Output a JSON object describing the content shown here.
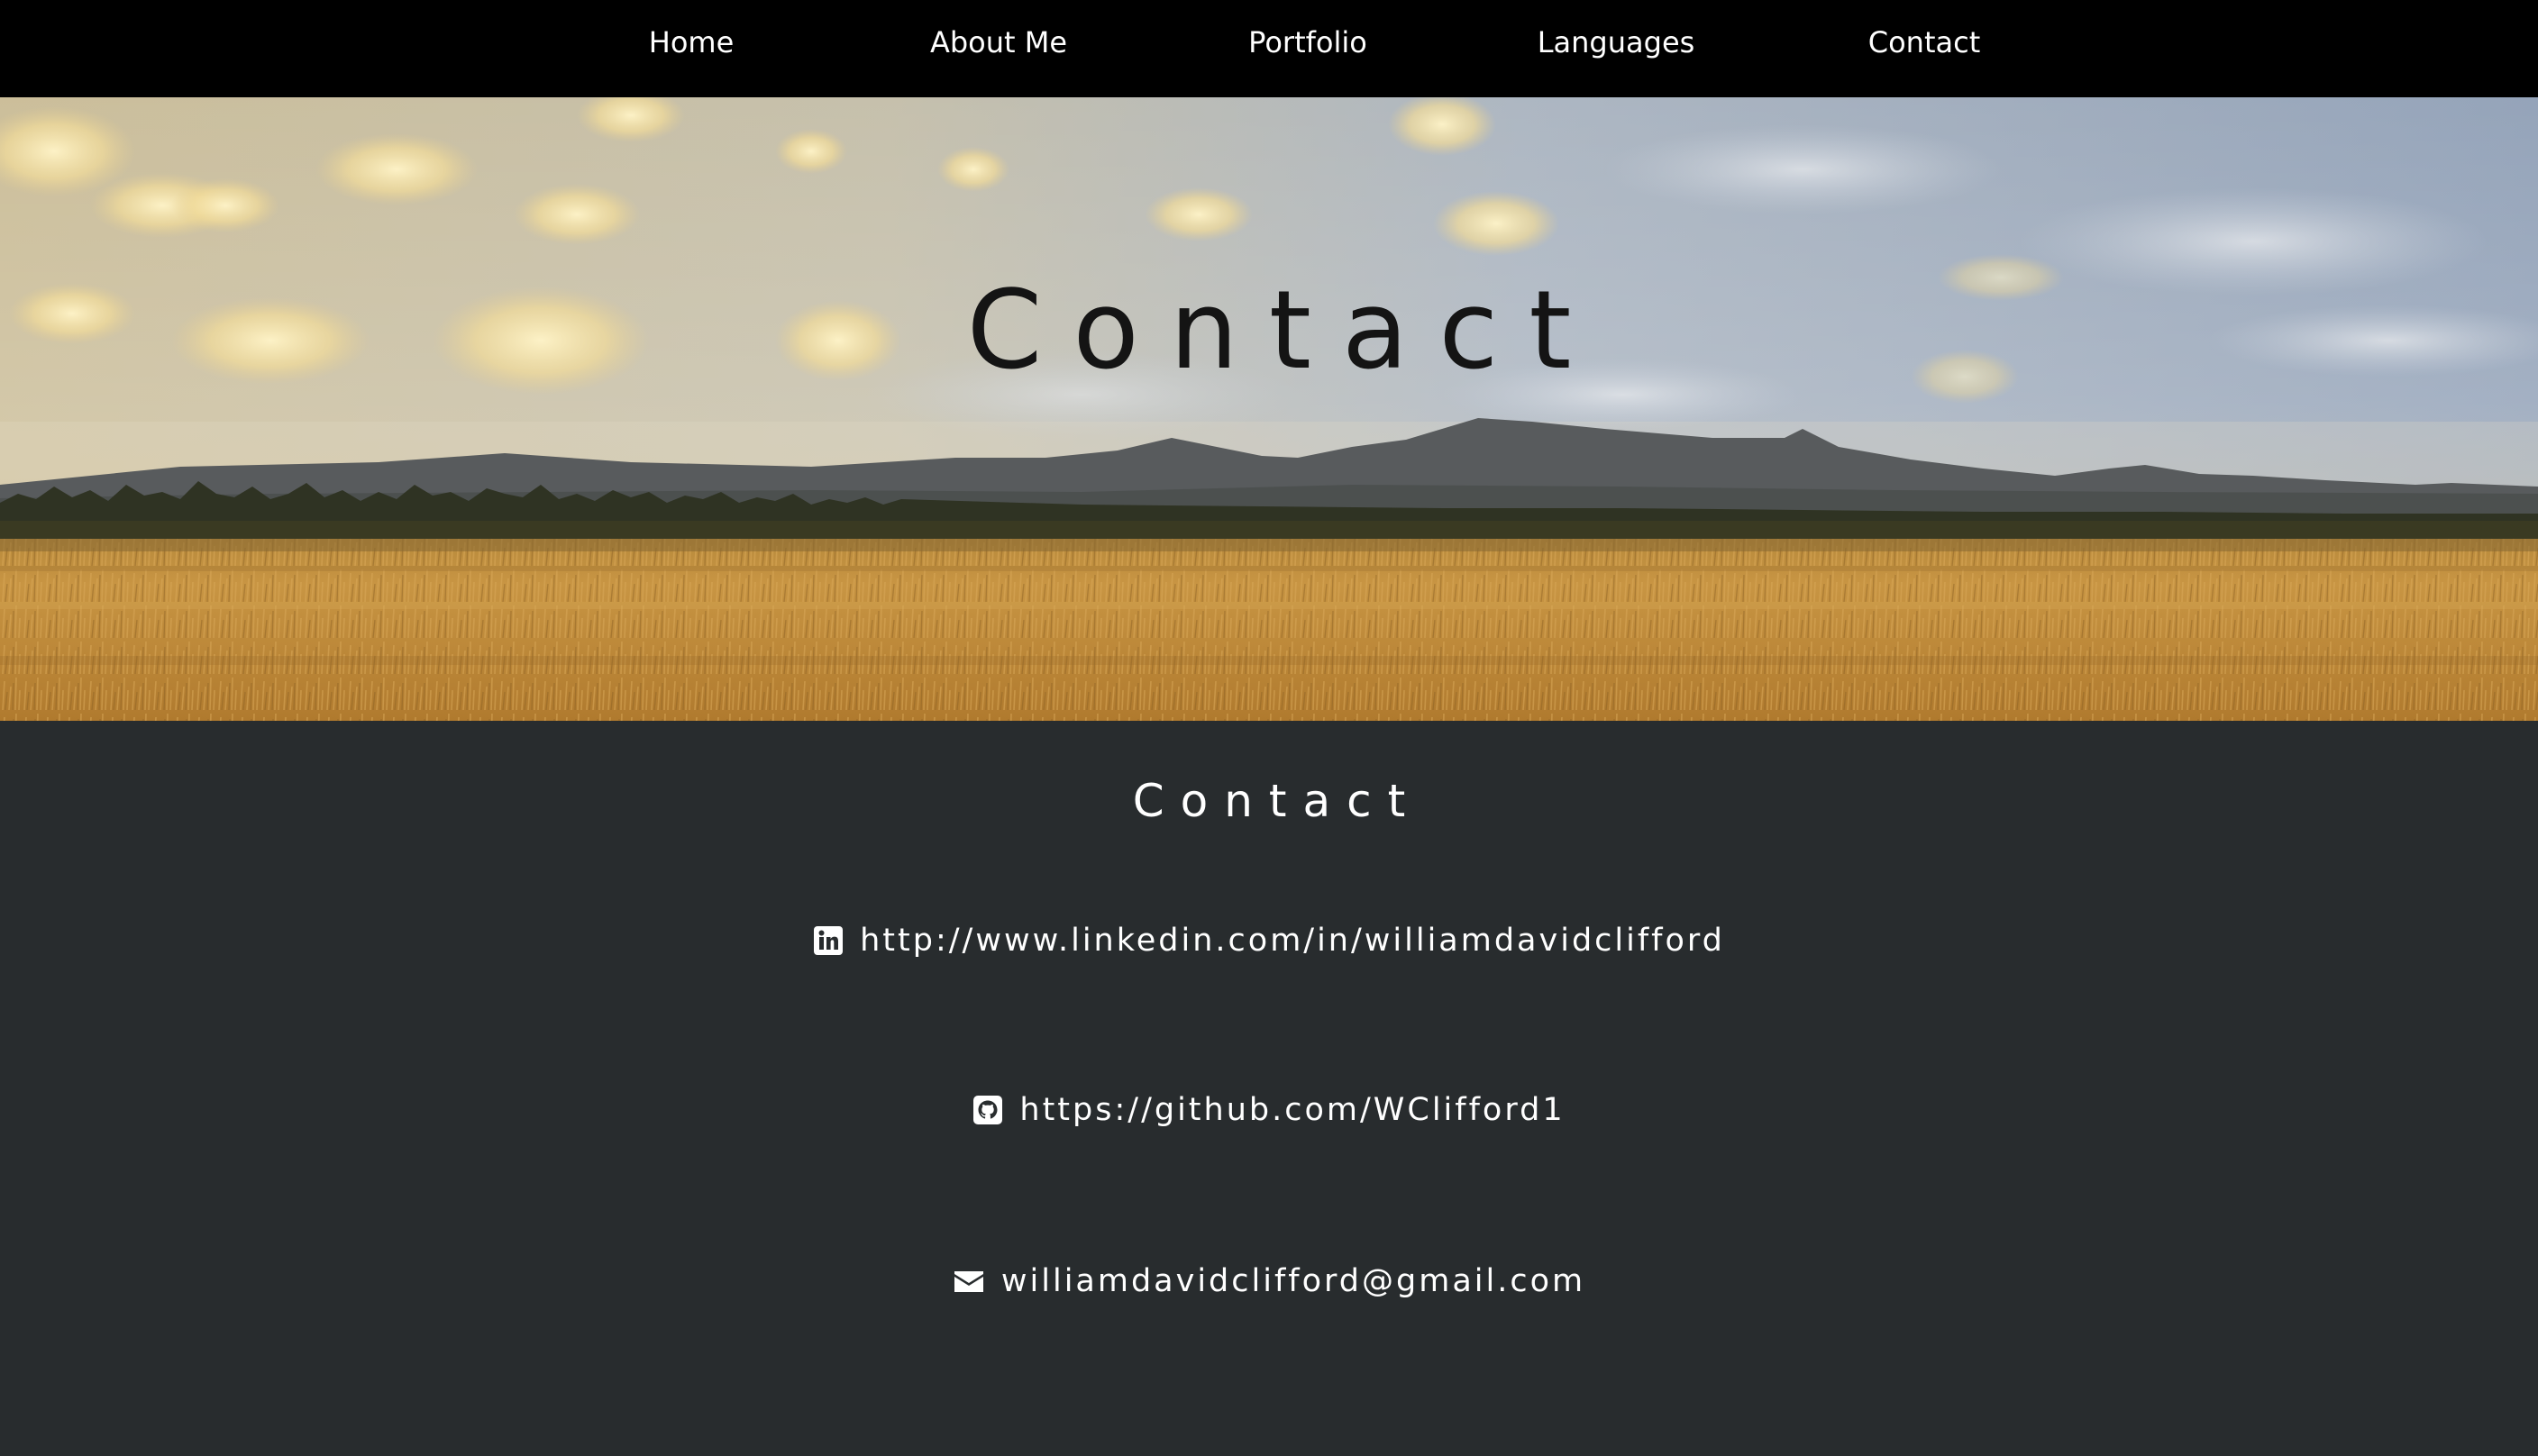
{
  "nav": {
    "items": [
      {
        "label": "Home"
      },
      {
        "label": "About Me"
      },
      {
        "label": "Portfolio"
      },
      {
        "label": "Languages"
      },
      {
        "label": "Contact"
      }
    ]
  },
  "hero": {
    "title": "Contact"
  },
  "contact": {
    "title": "Contact",
    "links": [
      {
        "icon": "linkedin-icon",
        "text": "http://www.linkedin.com/in/williamdavidclifford"
      },
      {
        "icon": "github-icon",
        "text": "https://github.com/WClifford1"
      },
      {
        "icon": "envelope-icon",
        "text": "williamdavidclifford@gmail.com"
      }
    ]
  },
  "colors": {
    "nav_background": "#000000",
    "section_background": "#282c2e",
    "text": "#ffffff",
    "hero_title": "#141414"
  }
}
